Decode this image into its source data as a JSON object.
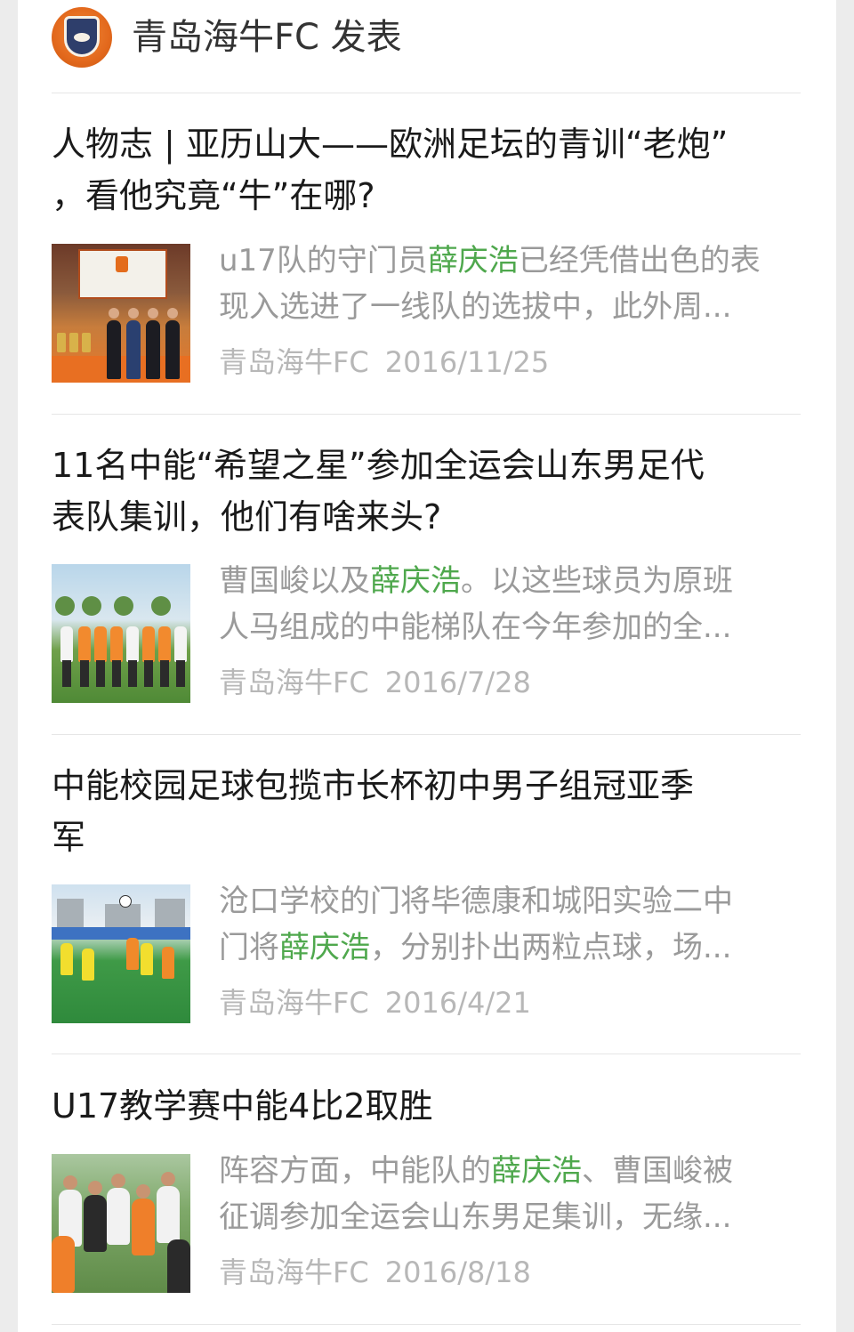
{
  "account": {
    "avatar_icon": "club-logo-icon",
    "title": "青岛海牛FC 发表"
  },
  "articles": [
    {
      "title": "人物志 | 亚历山大——欧洲足坛的青训“老炮”，看他究竟“牛”在哪?",
      "title_lines": [
        "人物志 | 亚历山大——欧洲足坛的青训“老炮”",
        "，看他究竟“牛”在哪?"
      ],
      "snippet_line1_pre": "u17队的守门员",
      "snippet_line1_hl": "薛庆浩",
      "snippet_line1_post": "已经凭借出色的表",
      "snippet_line2": "现入选进了一线队的选拔中，此外周...",
      "source": "青岛海牛FC",
      "date": "2016/11/25",
      "thumbnail_icon": "trophy-room-photo"
    },
    {
      "title": "11名中能“希望之星”参加全运会山东男足代表队集训，他们有啥来头?",
      "title_lines": [
        "11名中能“希望之星”参加全运会山东男足代",
        "表队集训，他们有啥来头?"
      ],
      "snippet_line1_pre": "曹国峻以及",
      "snippet_line1_hl": "薛庆浩",
      "snippet_line1_post": "。以这些球员为原班",
      "snippet_line2": "人马组成的中能梯队在今年参加的全...",
      "source": "青岛海牛FC",
      "date": "2016/7/28",
      "thumbnail_icon": "team-photo"
    },
    {
      "title": "中能校园足球包揽市长杯初中男子组冠亚季军",
      "title_lines": [
        "中能校园足球包揽市长杯初中男子组冠亚季",
        "军"
      ],
      "snippet_line1_pre": "沧口学校的门将毕德康和城阳实验二中",
      "snippet_line1_hl": "",
      "snippet_line1_post": "",
      "snippet_line2_pre": "门将",
      "snippet_line2_hl": "薛庆浩",
      "snippet_line2_post": "，分别扑出两粒点球，场...",
      "source": "青岛海牛FC",
      "date": "2016/4/21",
      "thumbnail_icon": "match-photo"
    },
    {
      "title": "U17教学赛中能4比2取胜",
      "title_lines": [
        "U17教学赛中能4比2取胜"
      ],
      "snippet_line1_pre": "阵容方面，中能队的",
      "snippet_line1_hl": "薛庆浩",
      "snippet_line1_post": "、曹国峻被",
      "snippet_line2": "征调参加全运会山东男足集训，无缘...",
      "source": "青岛海牛FC",
      "date": "2016/8/18",
      "thumbnail_icon": "team-huddle-photo"
    }
  ],
  "colors": {
    "highlight": "#4fa84d",
    "title": "#1a1a1a",
    "snippet": "#9a9a9a",
    "meta": "#b7b7b7",
    "avatar": "#e3691d"
  }
}
